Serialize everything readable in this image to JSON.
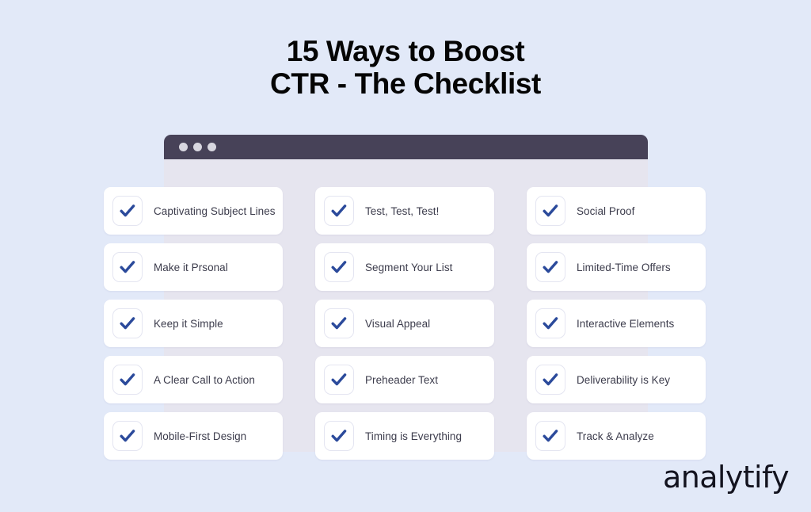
{
  "page": {
    "background_color": "#E2E9F8"
  },
  "title": {
    "line1": "15 Ways to Boost",
    "line2": "CTR - The Checklist"
  },
  "browser_mock": {
    "titlebar_color": "#474258",
    "body_color": "#E6E5EF",
    "dot_color": "#D8D7E0",
    "dots": [
      "window-dot-1",
      "window-dot-2",
      "window-dot-3"
    ]
  },
  "checklist": {
    "check_color": "#2B4A9B",
    "card_color": "#FFFFFF",
    "label_color": "#3C3C4C",
    "items": [
      {
        "label": "Captivating Subject Lines"
      },
      {
        "label": "Test, Test, Test!"
      },
      {
        "label": "Social Proof"
      },
      {
        "label": "Make it Prsonal"
      },
      {
        "label": "Segment Your List"
      },
      {
        "label": "Limited-Time Offers"
      },
      {
        "label": "Keep it Simple"
      },
      {
        "label": "Visual Appeal"
      },
      {
        "label": "Interactive Elements"
      },
      {
        "label": "A Clear Call to Action"
      },
      {
        "label": "Preheader Text"
      },
      {
        "label": "Deliverability is Key"
      },
      {
        "label": "Mobile-First Design"
      },
      {
        "label": "Timing is Everything"
      },
      {
        "label": "Track & Analyze"
      }
    ]
  },
  "logo": {
    "text": "analytify",
    "color": "#13131F"
  }
}
